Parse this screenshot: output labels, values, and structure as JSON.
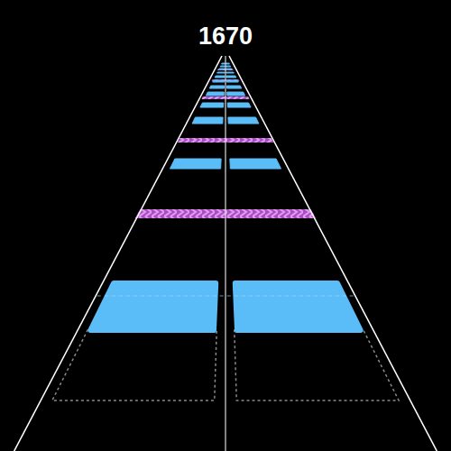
{
  "score": "1670"
}
